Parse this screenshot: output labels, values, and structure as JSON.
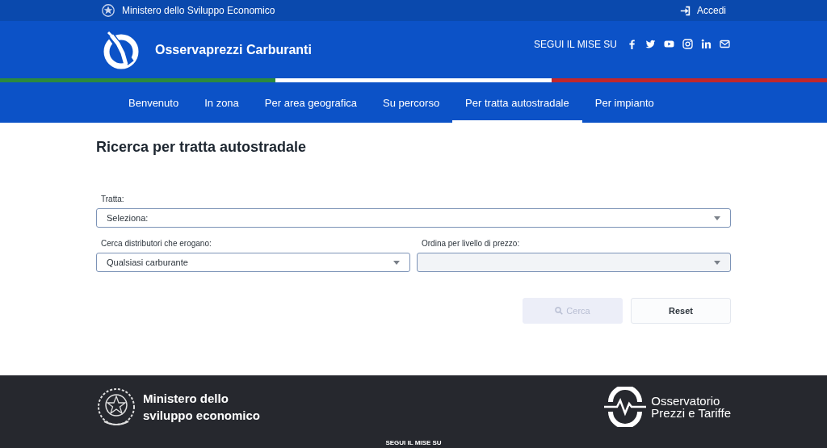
{
  "top_bar": {
    "ministry": "Ministero dello Sviluppo Economico",
    "login": "Accedi"
  },
  "header": {
    "title": "Osservaprezzi Carburanti",
    "social_label": "SEGUI IL MISE SU",
    "social": [
      {
        "kind": "facebook"
      },
      {
        "kind": "twitter"
      },
      {
        "kind": "youtube"
      },
      {
        "kind": "instagram"
      },
      {
        "kind": "linkedin"
      },
      {
        "kind": "mail"
      }
    ]
  },
  "nav": [
    {
      "label": "Benvenuto",
      "selected": false
    },
    {
      "label": "In zona",
      "selected": false
    },
    {
      "label": "Per area geografica",
      "selected": false
    },
    {
      "label": "Su percorso",
      "selected": false
    },
    {
      "label": "Per tratta autostradale",
      "selected": true
    },
    {
      "label": "Per impianto",
      "selected": false
    }
  ],
  "form": {
    "title": "Ricerca per tratta autostradale",
    "rows": [
      [
        {
          "label": "Tratta:",
          "value": "Seleziona:",
          "disabled": false
        }
      ],
      [
        {
          "label": "Cerca distributori che erogano:",
          "value": "Qualsiasi carburante",
          "disabled": false
        },
        {
          "label": "Ordina per livello di prezzo:",
          "disabled": true
        }
      ]
    ],
    "buttons": [
      {
        "label": "Cerca",
        "kind": "search",
        "disabled": true
      },
      {
        "label": "Reset",
        "kind": "plain",
        "disabled": false
      }
    ]
  },
  "footer": {
    "ministry_lines": [
      "Ministero dello",
      "sviluppo economico"
    ],
    "observatory_lines": [
      "Osservatorio",
      "Prezzi e Tariffe"
    ],
    "social_label": "SEGUI IL MISE SU"
  }
}
